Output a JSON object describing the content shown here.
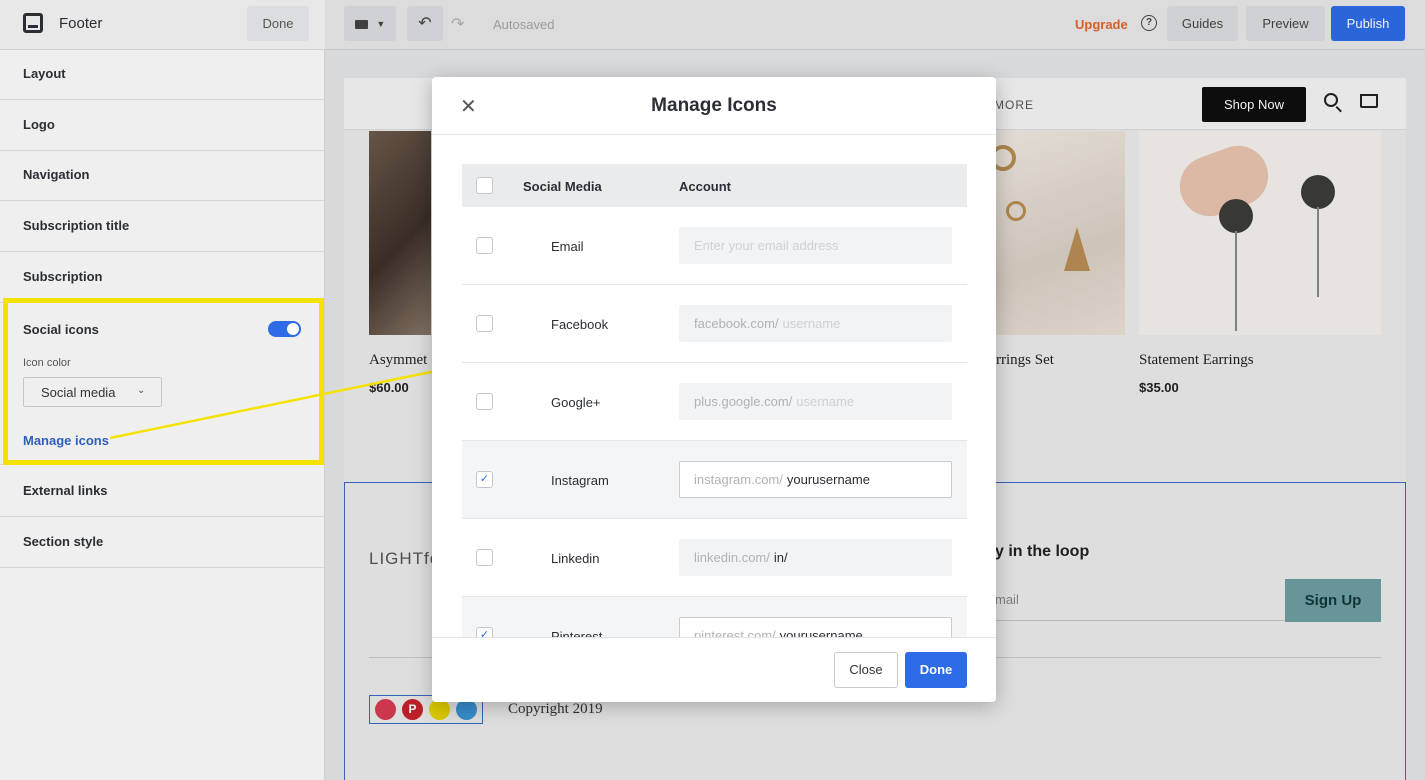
{
  "sidebar": {
    "title": "Footer",
    "done_label": "Done",
    "items": [
      {
        "label": "Layout"
      },
      {
        "label": "Logo"
      },
      {
        "label": "Navigation"
      },
      {
        "label": "Subscription title"
      },
      {
        "label": "Subscription"
      }
    ],
    "social": {
      "label": "Social icons",
      "toggle_on": true,
      "icon_color_label": "Icon color",
      "icon_color_value": "Social media",
      "manage_link": "Manage icons"
    },
    "items_after": [
      {
        "label": "External links"
      },
      {
        "label": "Section style"
      }
    ]
  },
  "topbar": {
    "autosaved": "Autosaved",
    "upgrade": "Upgrade",
    "guides": "Guides",
    "preview": "Preview",
    "publish": "Publish"
  },
  "site": {
    "nav_more": "MORE",
    "shop_now": "Shop Now",
    "products": [
      {
        "name": "Asymmet",
        "price": "$60.00"
      },
      {
        "name": "rrings Set",
        "price": ""
      },
      {
        "name": "Statement Earrings",
        "price": "$35.00"
      }
    ],
    "logo_text": "LIGHTfo",
    "loop_title": "y in the loop",
    "email_placeholder": "mail",
    "signup": "Sign Up",
    "copyright": "Copyright 2019"
  },
  "modal": {
    "title": "Manage Icons",
    "col_social": "Social Media",
    "col_account": "Account",
    "rows": [
      {
        "name": "Email",
        "checked": false,
        "prefix": "",
        "value": "",
        "placeholder": "Enter your email address"
      },
      {
        "name": "Facebook",
        "checked": false,
        "prefix": "facebook.com/",
        "value": "",
        "placeholder": "username"
      },
      {
        "name": "Google+",
        "checked": false,
        "prefix": "plus.google.com/",
        "value": "",
        "placeholder": "username"
      },
      {
        "name": "Instagram",
        "checked": true,
        "prefix": "instagram.com/",
        "value": "yourusername",
        "placeholder": ""
      },
      {
        "name": "Linkedin",
        "checked": false,
        "prefix": "linkedin.com/",
        "value": "in/",
        "placeholder": ""
      },
      {
        "name": "Pinterest",
        "checked": true,
        "prefix": "pinterest.com/",
        "value": "yourusername",
        "placeholder": ""
      }
    ],
    "close_label": "Close",
    "done_label": "Done"
  },
  "colors": {
    "accent": "#2e6be6",
    "highlight": "#f5e200",
    "upgrade": "#e2652a",
    "signup_bg": "#6e9ea0"
  }
}
